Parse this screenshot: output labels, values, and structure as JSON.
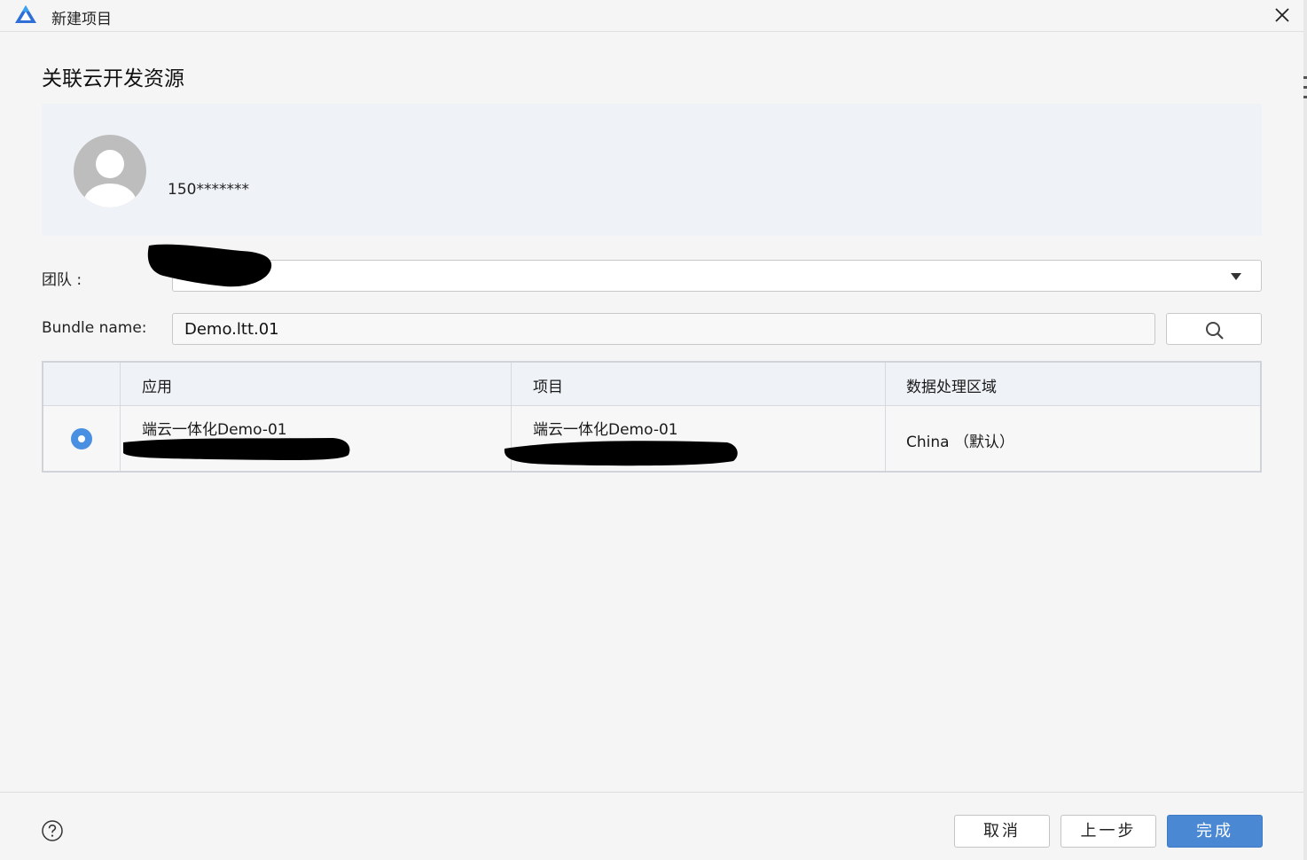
{
  "window": {
    "title": "新建项目",
    "logo_icon": "app-logo-icon",
    "close_icon": "close-icon"
  },
  "section": {
    "title": "关联云开发资源"
  },
  "account": {
    "avatar_icon": "avatar-icon",
    "name": "150*******"
  },
  "team": {
    "label": "团队 :",
    "value": "",
    "value_redacted": true
  },
  "bundle": {
    "label": "Bundle name:",
    "value": "Demo.ltt.01",
    "search_icon": "search-icon"
  },
  "table": {
    "headers": [
      "应用",
      "项目",
      "数据处理区域"
    ],
    "rows": [
      {
        "selected": true,
        "app": "端云一体化Demo-01",
        "project": "端云一体化Demo-01",
        "region": "China （默认）"
      }
    ]
  },
  "footer": {
    "help_icon": "help-icon",
    "cancel_label": "取消",
    "back_label": "上一步",
    "finish_label": "完成"
  },
  "colors": {
    "accent": "#4a88d3",
    "radio": "#4a90e2",
    "panel_bg": "#eff2f7",
    "page_bg": "#f5f5f5"
  }
}
